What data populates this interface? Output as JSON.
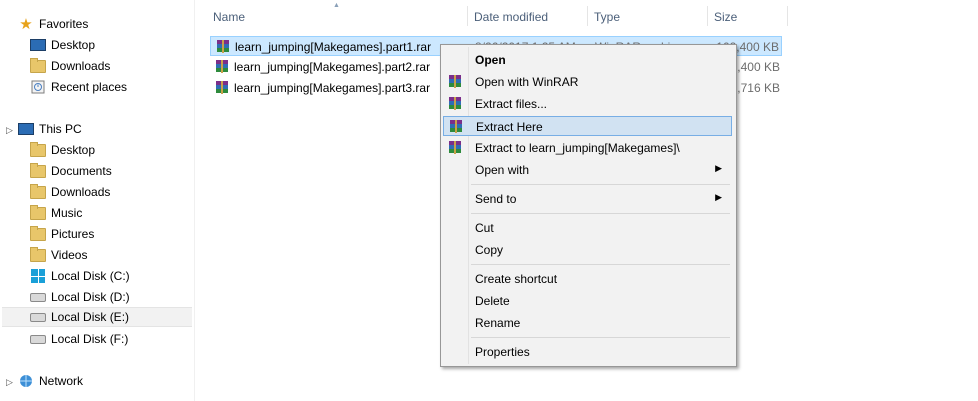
{
  "nav": {
    "favorites_label": "Favorites",
    "favorites": [
      "Desktop",
      "Downloads",
      "Recent places"
    ],
    "thispc_label": "This PC",
    "thispc": [
      "Desktop",
      "Documents",
      "Downloads",
      "Music",
      "Pictures",
      "Videos",
      "Local Disk (C:)",
      "Local Disk (D:)",
      "Local Disk (E:)",
      "Local Disk (F:)"
    ],
    "network_label": "Network",
    "icons": [
      "star-icon",
      "desktop-icon",
      "folder-icon",
      "recent-places-icon",
      "computer-icon",
      "drive-icon",
      "network-icon"
    ]
  },
  "columns": {
    "name": "Name",
    "date": "Date modified",
    "type": "Type",
    "size": "Size"
  },
  "files": [
    {
      "name": "learn_jumping[Makegames].part1.rar",
      "date": "8/26/2017 1:25 AM",
      "type": "WinRAR archive",
      "size": "102,400 KB"
    },
    {
      "name": "learn_jumping[Makegames].part2.rar",
      "date": "",
      "type": "",
      "size": "2,400 KB"
    },
    {
      "name": "learn_jumping[Makegames].part3.rar",
      "date": "",
      "type": "",
      "size": "2,716 KB"
    }
  ],
  "menu": {
    "open": "Open",
    "open_with_winrar": "Open with WinRAR",
    "extract_files": "Extract files...",
    "extract_here": "Extract Here",
    "extract_to": "Extract to learn_jumping[Makegames]\\",
    "open_with": "Open with",
    "send_to": "Send to",
    "cut": "Cut",
    "copy": "Copy",
    "create_shortcut": "Create shortcut",
    "delete": "Delete",
    "rename": "Rename",
    "properties": "Properties"
  },
  "colors": {
    "selection": "#cce8ff",
    "menu_highlight": "#d1e2f2",
    "header_text": "#4c607a"
  }
}
